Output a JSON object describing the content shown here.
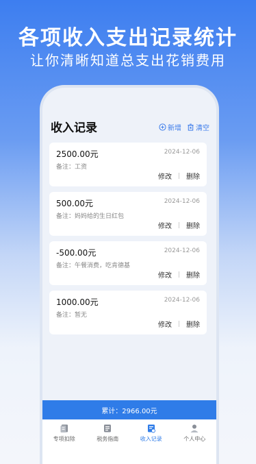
{
  "promo": {
    "title": "各项收入支出记录统计",
    "subtitle": "让你清晰知道总支出花销费用"
  },
  "header": {
    "title": "收入记录",
    "add_label": "新增",
    "clear_label": "清空"
  },
  "records": [
    {
      "amount": "2500.00元",
      "date": "2024-12-06",
      "note": "备注：工资",
      "edit": "修改",
      "delete": "删除"
    },
    {
      "amount": "500.00元",
      "date": "2024-12-06",
      "note": "备注：妈妈给的生日红包",
      "edit": "修改",
      "delete": "删除"
    },
    {
      "amount": "-500.00元",
      "date": "2024-12-06",
      "note": "备注：午餐消费，吃肯德基",
      "edit": "修改",
      "delete": "删除"
    },
    {
      "amount": "1000.00元",
      "date": "2024-12-06",
      "note": "备注：暂无",
      "edit": "修改",
      "delete": "删除"
    }
  ],
  "total": "累计：2966.00元",
  "tabs": [
    {
      "label": "专项扣除",
      "icon": "book-icon",
      "active": false
    },
    {
      "label": "税务指南",
      "icon": "guide-icon",
      "active": false
    },
    {
      "label": "收入记录",
      "icon": "record-icon",
      "active": true
    },
    {
      "label": "个人中心",
      "icon": "user-icon",
      "active": false
    }
  ],
  "colors": {
    "accent": "#2f7ce8",
    "background": "#eef2f9"
  }
}
